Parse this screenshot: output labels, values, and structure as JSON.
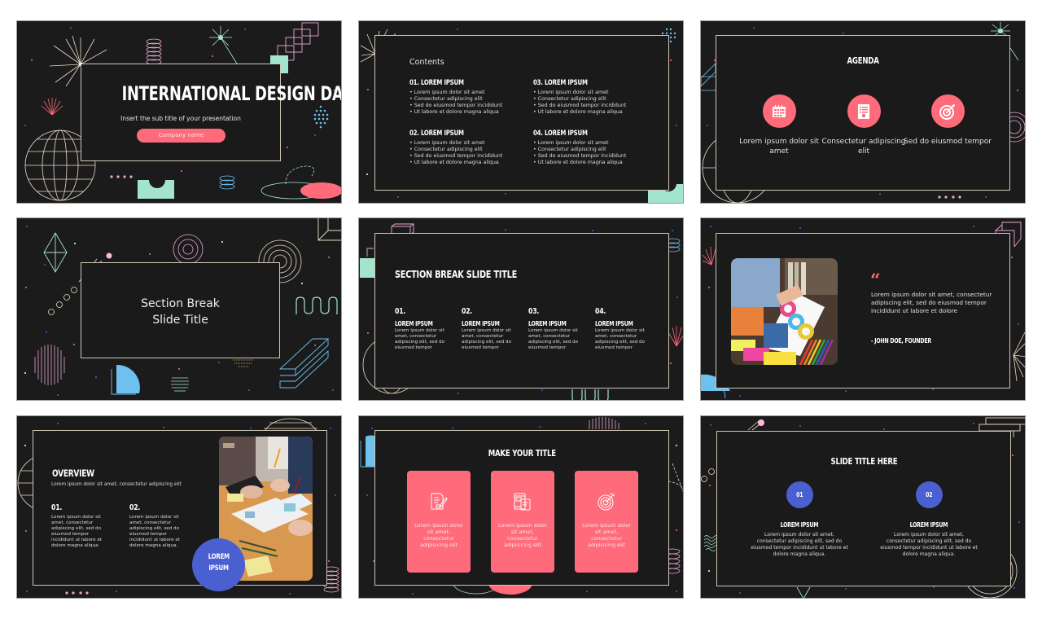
{
  "colors": {
    "background": "#1c1b1c",
    "frame_border": "#cfc6b4",
    "accent_coral": "#ff6b7a",
    "accent_blue": "#4a5fd0",
    "accent_mint": "#a3e4cc",
    "accent_sky": "#6ec1ee",
    "accent_lilac": "#e8a9d0",
    "text": "#ffffff"
  },
  "slides": [
    {
      "id": "title",
      "title": "INTERNATIONAL DESIGN DAY",
      "subtitle": "Insert the sub title of your presentation",
      "button_label": "Company name"
    },
    {
      "id": "contents",
      "heading": "Contents",
      "sections": [
        {
          "title": "01. LOREM IPSUM",
          "bullets": [
            "Lorem ipsum dolor sit amet",
            "Consectetur adipiscing elit",
            "Sed do eiusmod tempor incididunt",
            "Ut labore et dolore magna aliqua"
          ]
        },
        {
          "title": "02. LOREM IPSUM",
          "bullets": [
            "Lorem ipsum dolor sit amet",
            "Consectetur adipiscing elit",
            "Sed do eiusmod tempor incididunt",
            "Ut labore et dolore magna aliqua"
          ]
        },
        {
          "title": "03. LOREM IPSUM",
          "bullets": [
            "Lorem ipsum dolor sit amet",
            "Consectetur adipiscing elit",
            "Sed do eiusmod tempor incididunt",
            "Ut labore et dolore magna aliqua"
          ]
        },
        {
          "title": "04. LOREM IPSUM",
          "bullets": [
            "Lorem ipsum dolor sit amet",
            "Consectetur adipiscing elit",
            "Sed do eiusmod tempor incididunt",
            "Ut labore et dolore magna aliqua"
          ]
        }
      ]
    },
    {
      "id": "agenda",
      "heading": "AGENDA",
      "items": [
        {
          "icon": "calendar-icon",
          "label": "Lorem ipsum dolor sit amet"
        },
        {
          "icon": "document-list-icon",
          "label": "Consectetur adipiscing elit"
        },
        {
          "icon": "target-icon",
          "label": "Sed do eiusmod tempor"
        }
      ]
    },
    {
      "id": "section-break",
      "title_line1": "Section Break",
      "title_line2": "Slide Title"
    },
    {
      "id": "section-break-columns",
      "title": "SECTION BREAK SLIDE TITLE",
      "columns": [
        {
          "number": "01.",
          "title": "LOREM IPSUM",
          "body": "Lorem ipsum dolor sit amet, consectetur adipiscing elit, sed do eiusmod tempor"
        },
        {
          "number": "02.",
          "title": "LOREM IPSUM",
          "body": "Lorem ipsum dolor sit amet, consectetur adipiscing elit, sed do eiusmod tempor"
        },
        {
          "number": "03.",
          "title": "LOREM IPSUM",
          "body": "Lorem ipsum dolor sit amet, consectetur adipiscing elit, sed do eiusmod tempor"
        },
        {
          "number": "04.",
          "title": "LOREM IPSUM",
          "body": "Lorem ipsum dolor sit amet, consectetur adipiscing elit, sed do eiusmod tempor"
        }
      ]
    },
    {
      "id": "quote",
      "quote_mark": "“",
      "text": "Lorem ipsum dolor sit amet, consectetur adipiscing elit, sed do eiusmod tempor incididunt ut labore et dolore",
      "author": "- JOHN DOE, FOUNDER",
      "photo": "color-swatches-photo"
    },
    {
      "id": "overview",
      "title": "OVERVIEW",
      "subtitle": "Lorem ipsum dolor sit amet, consectetur adipiscing elit",
      "columns": [
        {
          "number": "01.",
          "body": "Lorem ipsum dolor sit amet, consectetur adipiscing elit, sed do eiusmod tempor incididunt ut labore et dolore magna aliqua."
        },
        {
          "number": "02.",
          "body": "Lorem ipsum dolor sit amet, consectetur adipiscing elit, sed do eiusmod tempor incididunt ut labore et dolore magna aliqua."
        }
      ],
      "badge_line1": "LOREM",
      "badge_line2": "IPSUM",
      "photo": "team-sketching-photo"
    },
    {
      "id": "make-your-title",
      "title": "MAKE YOUR TITLE",
      "cards": [
        {
          "icon": "document-edit-icon",
          "text": "Lorem ipsum dolor sit amet, consectetur adipisicing elit"
        },
        {
          "icon": "devices-icon",
          "text": "Lorem ipsum dolor sit amet, consectetur adipisicing elit"
        },
        {
          "icon": "target-icon",
          "text": "Lorem ipsum dolor sit amet, consectetur adipisicing elit"
        }
      ]
    },
    {
      "id": "slide-title-here",
      "title": "SLIDE TITLE HERE",
      "columns": [
        {
          "number": "01",
          "title": "LOREM IPSUM",
          "body": "Lorem ipsum dolor sit amet, consectetur adipiscing elit, sed do eiusmod tempor incididunt ut labore et dolore magna aliqua."
        },
        {
          "number": "02",
          "title": "LOREM IPSUM",
          "body": "Lorem ipsum dolor sit amet, consectetur adipiscing elit, sed do eiusmod tempor incididunt ut labore et dolore magna aliqua."
        }
      ]
    }
  ]
}
